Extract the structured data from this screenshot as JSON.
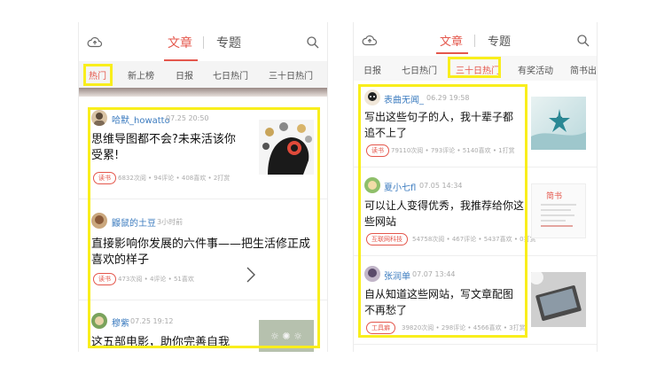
{
  "left": {
    "header": {
      "tab_article": "文章",
      "tab_topic": "专题",
      "upload_icon": "cloud-upload-icon",
      "search_icon": "search-icon"
    },
    "categories": [
      "热门",
      "新上榜",
      "日报",
      "七日热门",
      "三十日热门"
    ],
    "active_category": 0,
    "articles": [
      {
        "author": "哈默_howatto",
        "time": "07.25 20:50",
        "title": "思维导图都不会?未来活该你受累!",
        "tag": "读书",
        "stats": "6832次阅 • 94评论 • 408喜欢 • 2打赏"
      },
      {
        "author": "鼹鼠的土豆",
        "time": "3小时前",
        "title": "直接影响你发展的六件事——把生活修正成喜欢的样子",
        "tag": "读书",
        "stats": "473次阅 • 4评论 • 51喜欢"
      },
      {
        "author": "穆紫",
        "time": "07.25 19:12",
        "title": "这五部电影，助你完善自我",
        "tag": "",
        "stats": ""
      }
    ]
  },
  "right": {
    "header": {
      "tab_article": "文章",
      "tab_topic": "专题",
      "upload_icon": "cloud-upload-icon",
      "search_icon": "search-icon"
    },
    "categories": [
      "日报",
      "七日热门",
      "三十日热门",
      "有奖活动",
      "简书出版"
    ],
    "active_category": 2,
    "articles": [
      {
        "author": "表曲无闻_",
        "time": "06.29 19:58",
        "title": "写出这些句子的人，我十辈子都追不上了",
        "tag": "读书",
        "stats": "79110次阅 • 793评论 • 5140喜欢 • 1打赏"
      },
      {
        "author": "夏小七fl",
        "time": "07.05 14:34",
        "title": "可以让人变得优秀，我推荐给你这些网站",
        "tag": "互联网科技",
        "stats": "54758次阅 • 467评论 • 5437喜欢 • 0打赏"
      },
      {
        "author": "张润单",
        "time": "07.07 13:44",
        "title": "自从知道这些网站，写文章配图不再愁了",
        "tag": "工具癖",
        "stats": "39820次阅 • 298评论 • 4566喜欢 • 3打赏"
      }
    ],
    "thumb2_text": "简书"
  },
  "colors": {
    "accent": "#e4574c",
    "highlight": "#f9ee1c",
    "author": "#3b7bbf"
  }
}
